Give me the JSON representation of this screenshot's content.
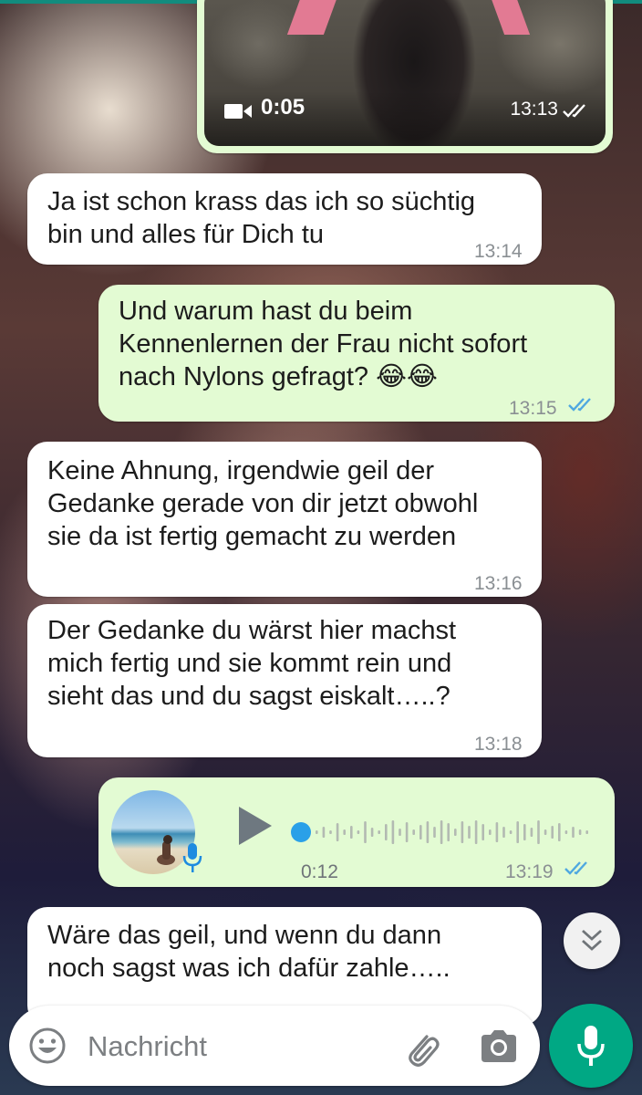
{
  "chat": {
    "video": {
      "duration": "0:05",
      "time": "13:13"
    },
    "messages": [
      {
        "direction": "incoming",
        "lines": [
          "Ja ist schon krass das ich so süchtig",
          "bin und alles für Dich tu"
        ],
        "time": "13:14"
      },
      {
        "direction": "outgoing",
        "lines": [
          "Und warum hast du beim",
          "Kennenlernen der Frau nicht sofort",
          "nach Nylons gefragt? 😂😂"
        ],
        "time": "13:15"
      },
      {
        "direction": "incoming",
        "lines": [
          "Keine Ahnung, irgendwie geil der",
          "Gedanke gerade von dir jetzt obwohl",
          "sie da ist fertig gemacht zu werden"
        ],
        "time": "13:16"
      },
      {
        "direction": "incoming",
        "lines": [
          "Der Gedanke du wärst hier machst",
          "mich fertig und sie kommt rein und",
          "sieht das und du sagst eiskalt…..?"
        ],
        "time": "13:18"
      },
      {
        "direction": "incoming",
        "lines": [
          "Wäre das geil, und wenn du dann",
          "noch sagst was ich dafür zahle….."
        ]
      }
    ],
    "voice": {
      "duration": "0:12",
      "time": "13:19",
      "progress": 0
    }
  },
  "composer": {
    "placeholder": "Nachricht"
  },
  "icons": {
    "video": "video-camera-icon",
    "read": "double-check-icon",
    "play": "play-icon",
    "mic": "microphone-icon",
    "emoji": "emoji-icon",
    "attach": "paperclip-icon",
    "camera": "camera-icon",
    "scroll": "chevrons-down-icon"
  },
  "colors": {
    "outgoing_bubble": "#e3fbd3",
    "incoming_bubble": "#ffffff",
    "read_ticks": "#4fa8e0",
    "accent": "#00a884"
  }
}
